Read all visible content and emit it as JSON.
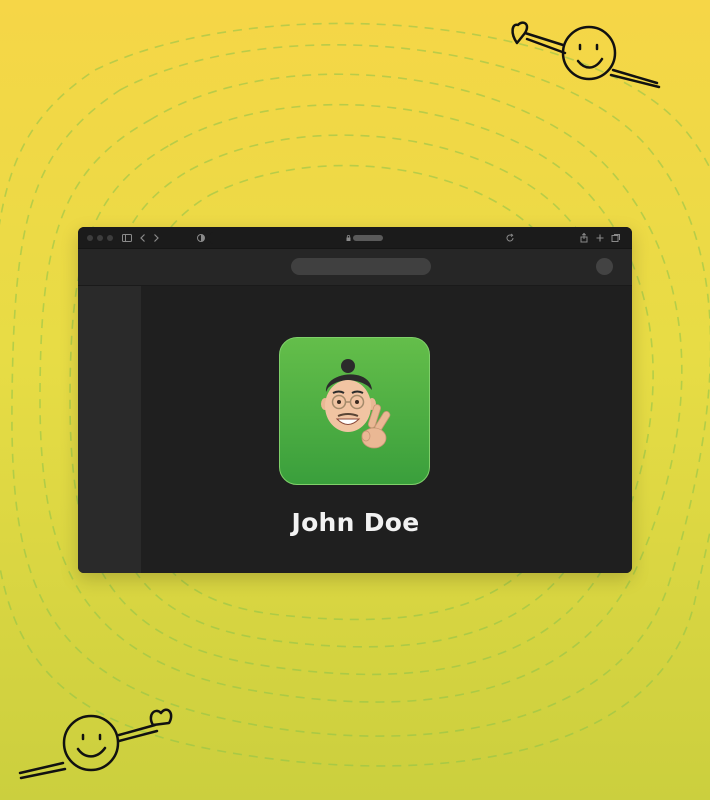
{
  "background": {
    "gradient_top": "#f6d647",
    "gradient_bottom": "#cbcf3e",
    "line_color": "#8bc34a"
  },
  "window": {
    "titlebar_icons": [
      "sidebar-toggle-icon",
      "back-chevron-icon",
      "forward-chevron-icon",
      "shield-icon",
      "lock-icon",
      "reload-icon",
      "share-icon",
      "plus-icon",
      "tabs-icon"
    ],
    "sidebar_color": "#2a2a2a",
    "content_color": "#1f1f1f"
  },
  "profile": {
    "name": "John Doe",
    "avatar_icon": "memoji-peace-sign",
    "avatar_gradient_top": "#64be4a",
    "avatar_gradient_bottom": "#3a9f3c"
  },
  "decorations": [
    "smiley-with-heart-icon",
    "smiley-with-heart-icon"
  ]
}
